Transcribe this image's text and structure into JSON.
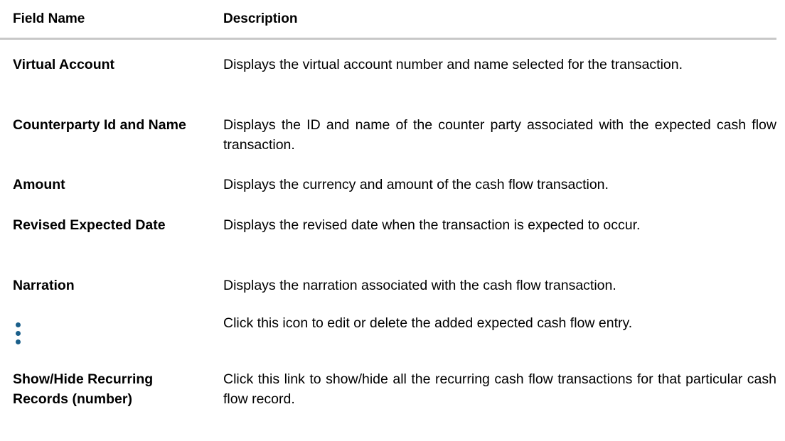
{
  "table": {
    "header": {
      "field_name": "Field Name",
      "description": "Description"
    },
    "rows": [
      {
        "field": "Virtual Account",
        "description": "Displays the virtual account number and name selected for the transaction."
      },
      {
        "field": "Counterparty Id and Name",
        "description": "Displays the ID and name of the counter party associated with the expected cash flow transaction."
      },
      {
        "field": "Amount",
        "description": "Displays the currency and amount of the cash flow transaction."
      },
      {
        "field": "Revised Expected Date",
        "description": "Displays the revised date when the transaction is expected to occur."
      },
      {
        "field": "Narration",
        "description": "Displays the narration associated with the cash flow transaction."
      },
      {
        "field_icon": "kebab-menu-icon",
        "description": "Click this icon to edit or delete the added expected cash flow entry."
      },
      {
        "field": "Show/Hide Recurring Records (number)",
        "description": "Click this link to show/hide all the recurring cash flow transactions for that particular cash flow record."
      }
    ]
  },
  "colors": {
    "header_rule": "#c8c8c8",
    "icon": "#1a5f8a"
  }
}
